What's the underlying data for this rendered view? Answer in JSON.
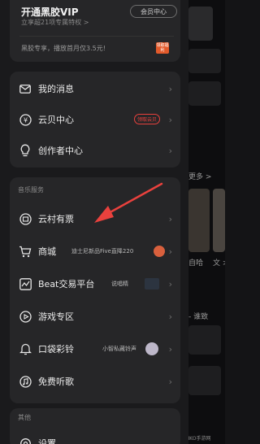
{
  "vip": {
    "title": "开通黑胶VIP",
    "subtitle": "立享超21项专属特权 >",
    "center_button": "会员中心",
    "promo": "黑胶专享，播放首月仅3.5元!",
    "badge": "领取福利"
  },
  "menu_top": [
    {
      "label": "我的消息",
      "icon": "mail-icon"
    },
    {
      "label": "云贝中心",
      "icon": "coin-icon",
      "badge": "领取云贝"
    },
    {
      "label": "创作者中心",
      "icon": "bulb-icon"
    }
  ],
  "music_service": {
    "title": "音乐服务",
    "items": [
      {
        "label": "云村有票",
        "icon": "ticket-icon"
      },
      {
        "label": "商城",
        "icon": "cart-icon",
        "extra": "迪士尼新品Five直降220"
      },
      {
        "label": "Beat交易平台",
        "icon": "beat-icon",
        "extra": "说唱精"
      },
      {
        "label": "游戏专区",
        "icon": "gamepad-icon"
      },
      {
        "label": "口袋彩铃",
        "icon": "bell-icon",
        "extra": "小智私藏铃声"
      },
      {
        "label": "免费听歌",
        "icon": "music-circle-icon"
      }
    ]
  },
  "other": {
    "title": "其他",
    "items": [
      {
        "label": "设置",
        "icon": "settings-icon"
      }
    ]
  },
  "background": {
    "more": "更多 >",
    "caption1": "自哈",
    "caption2": "文 >",
    "caption3": "- 谁致",
    "watermark": "MKO手游网"
  },
  "colors": {
    "accent_red": "#e9413d",
    "vip_badge": "#e25a2b",
    "background": "#1a1a1c",
    "card": "#262628"
  }
}
